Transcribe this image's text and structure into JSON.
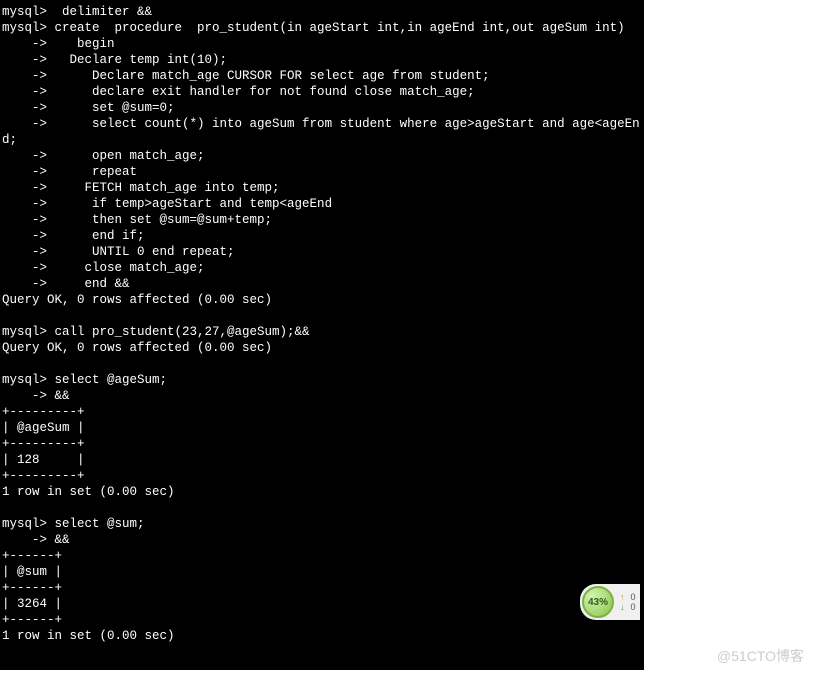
{
  "terminal": {
    "lines": [
      "mysql>  delimiter &&",
      "mysql> create  procedure  pro_student(in ageStart int,in ageEnd int,out ageSum int)",
      "    ->    begin",
      "    ->   Declare temp int(10);",
      "    ->      Declare match_age CURSOR FOR select age from student;",
      "    ->      declare exit handler for not found close match_age;",
      "    ->      set @sum=0;",
      "    ->      select count(*) into ageSum from student where age>ageStart and age<ageEnd;",
      "    ->      open match_age;",
      "    ->      repeat",
      "    ->     FETCH match_age into temp;",
      "    ->      if temp>ageStart and temp<ageEnd",
      "    ->      then set @sum=@sum+temp;",
      "    ->      end if;",
      "    ->      UNTIL 0 end repeat;",
      "    ->     close match_age;",
      "    ->     end &&",
      "Query OK, 0 rows affected (0.00 sec)",
      "",
      "mysql> call pro_student(23,27,@ageSum);&&",
      "Query OK, 0 rows affected (0.00 sec)",
      "",
      "mysql> select @ageSum;",
      "    -> &&",
      "+---------+",
      "| @ageSum |",
      "+---------+",
      "| 128     |",
      "+---------+",
      "1 row in set (0.00 sec)",
      "",
      "mysql> select @sum;",
      "    -> &&",
      "+------+",
      "| @sum |",
      "+------+",
      "| 3264 |",
      "+------+",
      "1 row in set (0.00 sec)",
      ""
    ]
  },
  "indicator": {
    "percent": "43%",
    "up_value": "0",
    "down_value": "0"
  },
  "watermark": "@51CTO博客"
}
